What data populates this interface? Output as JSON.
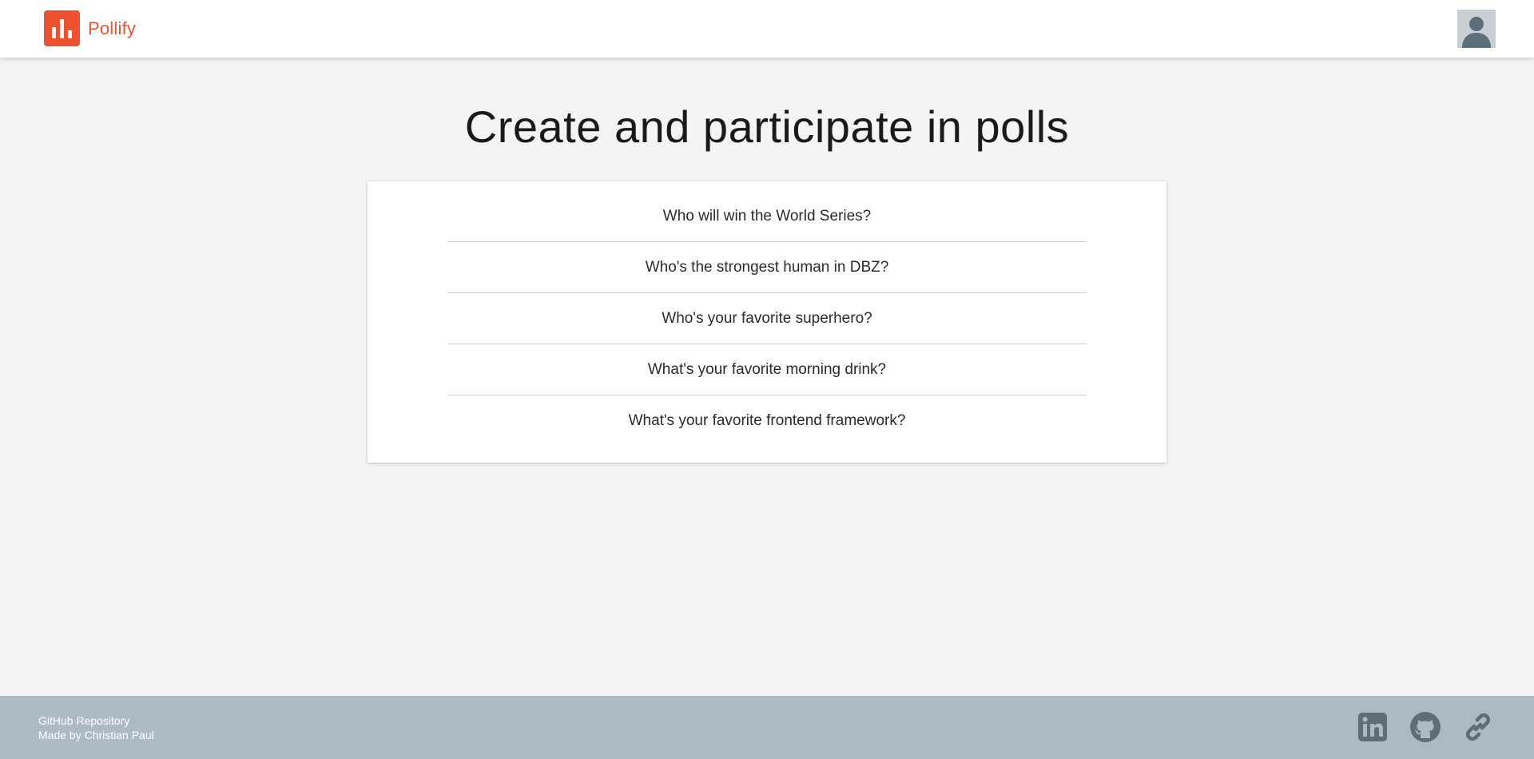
{
  "colors": {
    "brand": "#ee5130",
    "footer_bg": "#abbbc3",
    "footer_icon": "#5f6e75"
  },
  "header": {
    "brand_name": "Pollify",
    "logo_icon": "bar-chart-icon",
    "avatar_icon": "user-silhouette-icon"
  },
  "main": {
    "title": "Create and participate in polls",
    "polls": [
      {
        "question": "Who will win the World Series?"
      },
      {
        "question": "Who's the strongest human in DBZ?"
      },
      {
        "question": "Who's your favorite superhero?"
      },
      {
        "question": "What's your favorite morning drink?"
      },
      {
        "question": "What's your favorite frontend framework?"
      }
    ]
  },
  "footer": {
    "repo_link": "GitHub Repository",
    "author_link": "Made by Christian Paul",
    "social": [
      "linkedin-icon",
      "github-icon",
      "link-icon"
    ]
  }
}
